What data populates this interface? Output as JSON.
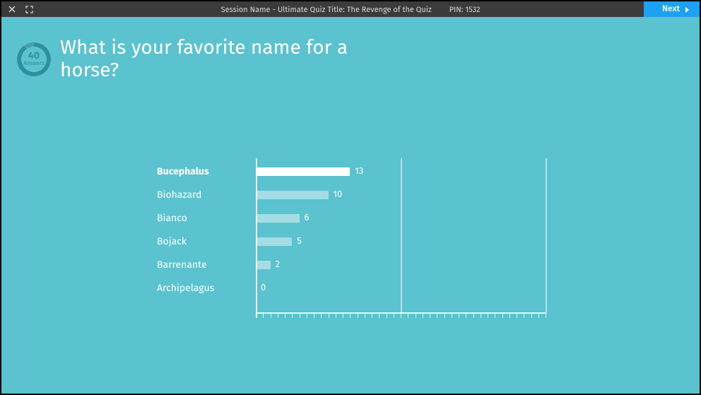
{
  "topbar": {
    "session_label": "Session Name",
    "separator": " - ",
    "quiz_title": "Ultimate Quiz Title: The Revenge of the Quiz",
    "pin_label": "PIN:",
    "pin_value": "1532",
    "next_label": "Next"
  },
  "badge": {
    "count": "40",
    "label": "Answers"
  },
  "question": "What is your favorite name for a horse?",
  "chart_data": {
    "type": "bar",
    "orientation": "horizontal",
    "title": "What is your favorite name for a horse?",
    "categories": [
      "Bucephalus",
      "Biohazard",
      "Bianco",
      "Bojack",
      "Barrenante",
      "Archipelagus"
    ],
    "values": [
      13,
      10,
      6,
      5,
      2,
      0
    ],
    "xlabel": "",
    "ylabel": "",
    "xlim": [
      0,
      40
    ],
    "gridlines_x": [
      0,
      20,
      40
    ],
    "ticks_minor": 1,
    "highlight_top": true
  }
}
